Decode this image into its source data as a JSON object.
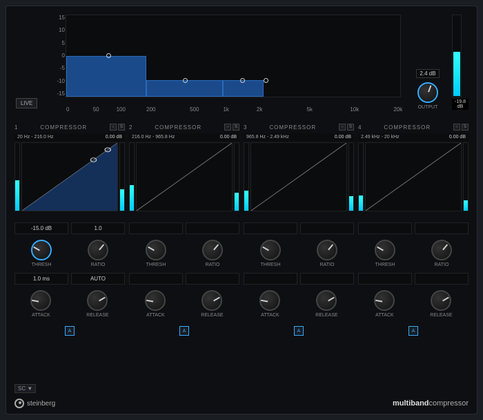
{
  "spectrum": {
    "y_labels": [
      "15",
      "10",
      "5",
      "0",
      "-5",
      "-10",
      "-15"
    ],
    "x_labels": [
      {
        "v": "0",
        "p": 0
      },
      {
        "v": "50",
        "p": 8
      },
      {
        "v": "100",
        "p": 15
      },
      {
        "v": "200",
        "p": 24
      },
      {
        "v": "500",
        "p": 37
      },
      {
        "v": "1k",
        "p": 47
      },
      {
        "v": "2k",
        "p": 57
      },
      {
        "v": "5k",
        "p": 72
      },
      {
        "v": "10k",
        "p": 85
      },
      {
        "v": "20k",
        "p": 98
      }
    ],
    "live_label": "LIVE"
  },
  "output": {
    "gain_value": "2.4 dB",
    "label": "OUTPUT",
    "readout": "-19.8 dB"
  },
  "bands": [
    {
      "num": "1",
      "title": "COMPRESSOR",
      "freq_lo": "20 Hz",
      "freq_hi": "216.0 Hz",
      "gain": "0.00 dB",
      "meter": 45,
      "active": true
    },
    {
      "num": "2",
      "title": "COMPRESSOR",
      "freq_lo": "216.0 Hz",
      "freq_hi": "965.8 Hz",
      "gain": "0.00 dB",
      "meter": 38,
      "active": false
    },
    {
      "num": "3",
      "title": "COMPRESSOR",
      "freq_lo": "965.8 Hz",
      "freq_hi": "2.49 kHz",
      "gain": "0.00 dB",
      "meter": 30,
      "active": false
    },
    {
      "num": "4",
      "title": "COMPRESSOR",
      "freq_lo": "2.49 kHz",
      "freq_hi": "20 kHz",
      "gain": "0.00 dB",
      "meter": 22,
      "active": false
    }
  ],
  "controls": [
    {
      "thresh_val": "-15.0 dB",
      "ratio_val": "1.0",
      "attack_val": "1.0 ms",
      "release_val": "AUTO",
      "active": true
    },
    {
      "thresh_val": "",
      "ratio_val": "",
      "attack_val": "",
      "release_val": "",
      "active": false
    },
    {
      "thresh_val": "",
      "ratio_val": "",
      "attack_val": "",
      "release_val": "",
      "active": false
    },
    {
      "thresh_val": "",
      "ratio_val": "",
      "attack_val": "",
      "release_val": "",
      "active": false
    }
  ],
  "labels": {
    "thresh": "THRESH",
    "ratio": "RATIO",
    "attack": "ATTACK",
    "release": "RELEASE",
    "auto": "A"
  },
  "footer": {
    "sc": "SC ▼",
    "brand": "steinberg",
    "product_bold": "multiband",
    "product_light": "compressor"
  }
}
